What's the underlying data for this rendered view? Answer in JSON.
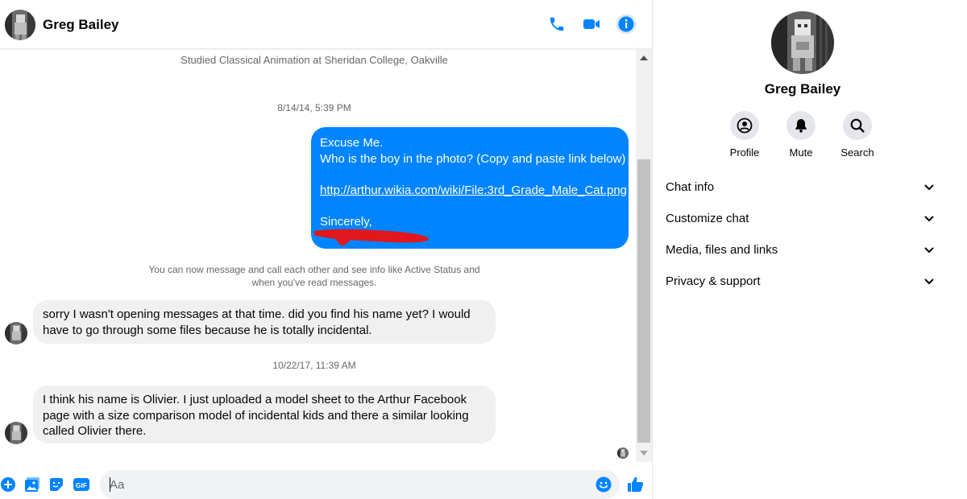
{
  "header": {
    "name": "Greg Bailey",
    "icons": [
      "phone-icon",
      "video-icon",
      "info-icon"
    ]
  },
  "conversation": {
    "profile_line": "Studied Classical Animation at Sheridan College, Oakville",
    "timestamp_1": "8/14/14, 5:39 PM",
    "outgoing": {
      "line1": "Excuse Me.",
      "line2": "Who is the boy in the photo? (Copy and paste link below)",
      "link": "http://arthur.wikia.com/wiki/File:3rd_Grade_Male_Cat.png",
      "signoff": "Sincerely,"
    },
    "notice": "You can now message and call each other and see info like Active Status and when you've read messages.",
    "incoming_1": "sorry I wasn't opening messages at that time. did you find his name yet? I would have to go through some files because he is totally incidental.",
    "timestamp_2": "10/22/17, 11:39 AM",
    "incoming_2": "I think his name is Olivier. I just uploaded a model sheet to the Arthur Facebook page with a size comparison model of incidental kids and there a similar looking called Olivier there."
  },
  "composer": {
    "placeholder": "Aa",
    "icons": [
      "plus-icon",
      "image-icon",
      "sticker-icon",
      "gif-icon",
      "emoji-icon",
      "thumbs-up-icon"
    ],
    "gif_label": "GIF"
  },
  "info_panel": {
    "name": "Greg Bailey",
    "actions": [
      {
        "label": "Profile",
        "icon": "profile-icon"
      },
      {
        "label": "Mute",
        "icon": "bell-icon"
      },
      {
        "label": "Search",
        "icon": "search-icon"
      }
    ],
    "sections": [
      {
        "label": "Chat info"
      },
      {
        "label": "Customize chat"
      },
      {
        "label": "Media, files and links"
      },
      {
        "label": "Privacy & support"
      }
    ]
  },
  "colors": {
    "accent": "#0084ff",
    "incoming_bubble": "#f0f0f0",
    "muted_text": "#65676b",
    "redaction": "#e0171c"
  }
}
